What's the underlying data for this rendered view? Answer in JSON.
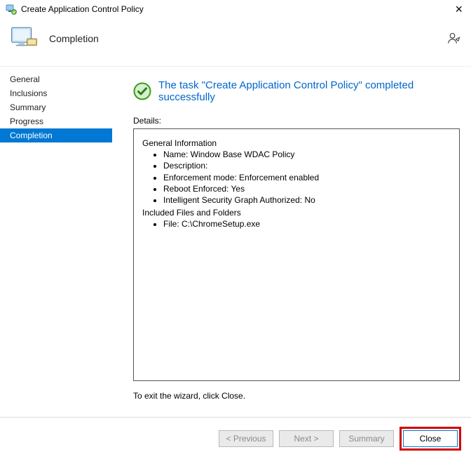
{
  "window": {
    "title": "Create Application Control Policy"
  },
  "header": {
    "page_title": "Completion"
  },
  "sidebar": {
    "items": [
      {
        "label": "General"
      },
      {
        "label": "Inclusions"
      },
      {
        "label": "Summary"
      },
      {
        "label": "Progress"
      },
      {
        "label": "Completion"
      }
    ],
    "selected_index": 4
  },
  "content": {
    "success_message": "The task \"Create Application Control Policy\" completed successfully",
    "details_label": "Details:",
    "details": {
      "heading_general": "General Information",
      "name_line": "Name: Window Base WDAC Policy",
      "description_line": "Description:",
      "enforcement_line": "Enforcement mode: Enforcement enabled",
      "reboot_line": "Reboot Enforced: Yes",
      "isg_line": "Intelligent Security Graph Authorized: No",
      "heading_included": "Included Files and Folders",
      "file_line": "File: C:\\ChromeSetup.exe"
    },
    "exit_hint": "To exit the wizard, click Close."
  },
  "footer": {
    "previous": "< Previous",
    "next": "Next >",
    "summary": "Summary",
    "close": "Close"
  }
}
